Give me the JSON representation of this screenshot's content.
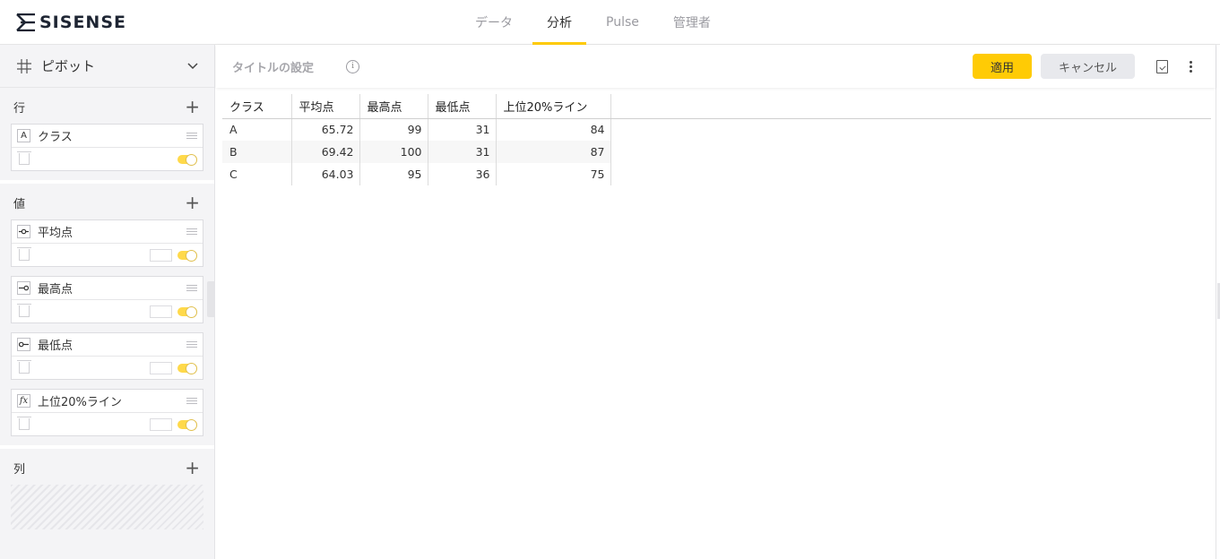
{
  "app": {
    "logo_text": "SISENSE"
  },
  "nav": {
    "tabs": [
      {
        "label": "データ",
        "active": false
      },
      {
        "label": "分析",
        "active": true
      },
      {
        "label": "Pulse",
        "active": false
      },
      {
        "label": "管理者",
        "active": false
      }
    ]
  },
  "sidebar": {
    "widget_type": "ピボット",
    "rows_section": {
      "title": "行",
      "items": [
        {
          "type_badge": "A",
          "label": "クラス"
        }
      ]
    },
    "values_section": {
      "title": "値",
      "items": [
        {
          "icon": "avg-icon",
          "label": "平均点"
        },
        {
          "icon": "max-icon",
          "label": "最高点"
        },
        {
          "icon": "min-icon",
          "label": "最低点"
        },
        {
          "icon": "formula-icon",
          "type_badge": "fx",
          "label": "上位20%ライン"
        }
      ]
    },
    "columns_section": {
      "title": "列"
    }
  },
  "editor": {
    "title_placeholder": "タイトルの設定",
    "apply_label": "適用",
    "cancel_label": "キャンセル"
  },
  "pivot": {
    "headers": [
      "クラス",
      "平均点",
      "最高点",
      "最低点",
      "上位20%ライン"
    ],
    "rows": [
      [
        "A",
        "65.72",
        "99",
        "31",
        "84"
      ],
      [
        "B",
        "69.42",
        "100",
        "31",
        "87"
      ],
      [
        "C",
        "64.03",
        "95",
        "36",
        "75"
      ]
    ]
  },
  "colors": {
    "accent": "#ffcb05",
    "toggle": "#ffd94a"
  }
}
